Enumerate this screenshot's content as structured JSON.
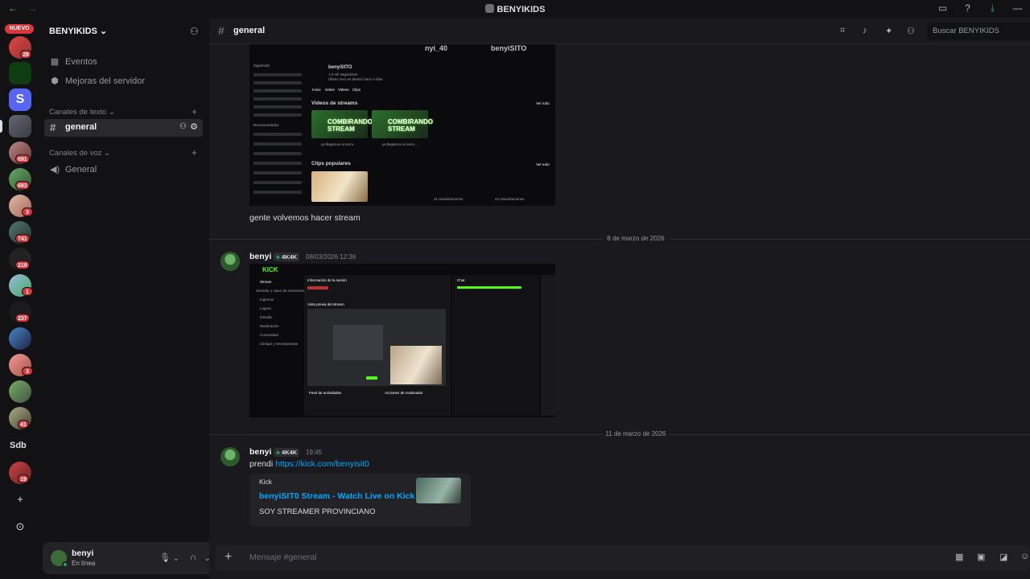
{
  "window": {
    "title": "BENYIKIDS",
    "back_icon": "←",
    "forward_icon": "→",
    "controls": [
      "▭",
      "?",
      "⤓",
      "—"
    ]
  },
  "rail": {
    "nuevo": "NUEVO",
    "badges": [
      "28",
      "691",
      "683",
      "3",
      "741",
      "219",
      "1",
      "237",
      "3",
      "41",
      "19"
    ],
    "folder_label": "Sdb",
    "add_icon": "+",
    "discover_icon": "⊙"
  },
  "sidebar": {
    "server_name": "BENYIKIDS",
    "items": [
      {
        "label": "Eventos"
      },
      {
        "label": "Mejoras del servidor"
      }
    ],
    "categories": [
      {
        "label": "Canales de texto"
      },
      {
        "label": "Canales de voz"
      }
    ],
    "text_channel": "general",
    "voice_channel": "General"
  },
  "user": {
    "name": "benyi",
    "status": "En línea"
  },
  "header": {
    "channel": "general",
    "search_placeholder": "Buscar BENYIKIDS"
  },
  "messages": [
    {
      "text": "gente volvemos hacer stream",
      "screenshot": {
        "header_left": "nyi_40",
        "header_right": "benyiSITO",
        "profile_name": "benyiSITO",
        "profile_sub": "1,6 mil seguidores",
        "profile_meta": "Último vivo en directo hace 3 días",
        "tabs": [
          "Inicio",
          "Sobre",
          "Videos",
          "Clips"
        ],
        "videos_title": "Videos de streams",
        "clips_title": "Clips populares",
        "see_all": "Ver todo",
        "thumb_text": "COMBIRANDO STREAM",
        "video_titles": [
          "ya llegamos al cerro...",
          "ya llegamos al cerro..."
        ],
        "clip_meta": [
          "41 visualizaciones",
          "23 visualizaciones"
        ],
        "side_labels": [
          "Siguiendo",
          "Recomendados"
        ]
      }
    },
    {
      "date": "8 de marzo de 2026",
      "author": "benyi",
      "tag": "4K4K",
      "time": "08/03/2026 12:36",
      "screenshot": {
        "logo": "KICK",
        "nav": [
          "Stream",
          "Servidor y clave de retransmisión",
          "Ingresos",
          "Logros",
          "Estudio",
          "Moderación",
          "Comunidad",
          "Clinapo y recompensas"
        ],
        "panel_titles": [
          "Información de la sesión",
          "Chat",
          "Vista previa del stream",
          "Feed de actividades",
          "Acciones de moderador"
        ]
      }
    },
    {
      "date": "11 de marzo de 2026",
      "author": "benyi",
      "tag": "4K4K",
      "time": "19:45",
      "text_prefix": "prendi ",
      "link": "https://kick.com/benyisit0",
      "embed": {
        "provider": "Kick",
        "title": "benyiSIT0 Stream - Watch Live on Kick",
        "description": "SOY STREAMER PROVINCIANO"
      }
    }
  ],
  "composer": {
    "placeholder": "Mensaje #general"
  },
  "colors": {
    "accent_green": "#23a55a",
    "kick_green": "#53fc18",
    "link": "#00a8fc",
    "badge_red": "#da373c"
  }
}
